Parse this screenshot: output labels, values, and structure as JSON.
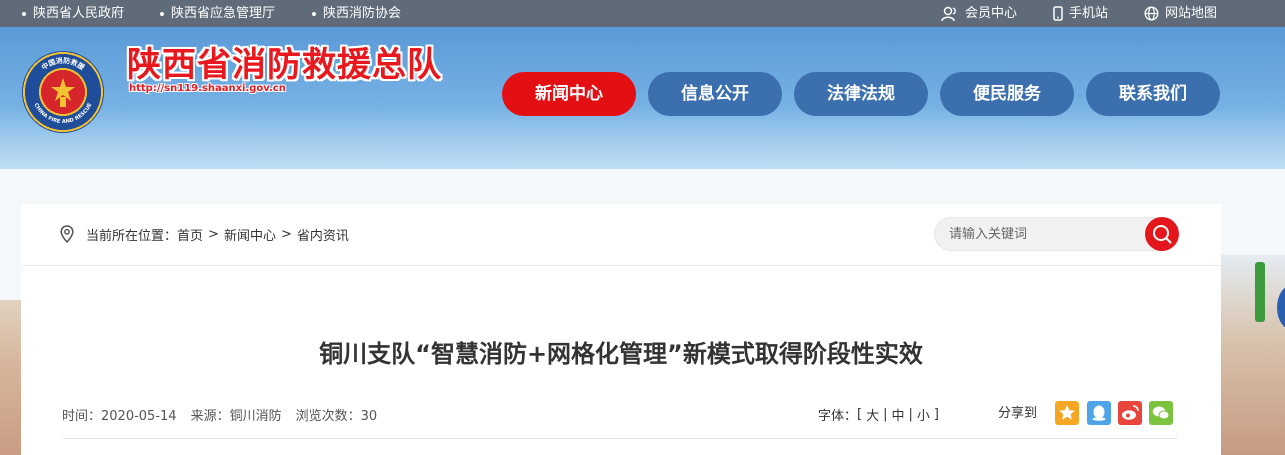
{
  "topbar": {
    "left_links": [
      "陕西省人民政府",
      "陕西省应急管理厅",
      "陕西消防协会"
    ],
    "right_links": [
      {
        "label": "会员中心",
        "icon": "user-icon"
      },
      {
        "label": "手机站",
        "icon": "mobile-icon"
      },
      {
        "label": "网站地图",
        "icon": "globe-icon"
      }
    ]
  },
  "header": {
    "site_title": "陕西省消防救援总队",
    "site_url": "http://sn119.shaanxi.gov.cn",
    "emblem_top_text": "中国消防救援",
    "emblem_ring_text": "CHINA FIRE AND RESCUE"
  },
  "nav": {
    "items": [
      {
        "label": "新闻中心",
        "active": true
      },
      {
        "label": "信息公开",
        "active": false
      },
      {
        "label": "法律法规",
        "active": false
      },
      {
        "label": "便民服务",
        "active": false
      },
      {
        "label": "联系我们",
        "active": false
      }
    ]
  },
  "breadcrumb": {
    "prefix": "当前所在位置：",
    "items": [
      "首页",
      "新闻中心",
      "省内资讯"
    ],
    "separator": ">"
  },
  "search": {
    "placeholder": "请输入关键词",
    "value": ""
  },
  "article": {
    "title": "铜川支队“智慧消防+网格化管理”新模式取得阶段性实效",
    "time_label": "时间：2020-05-14",
    "source_label": "来源：铜川消防",
    "views_label": "浏览次数：30"
  },
  "font_size": {
    "label": "字体：",
    "open": "[",
    "large": "大",
    "medium": "中",
    "small": "小",
    "close": "]",
    "sep": "|"
  },
  "share": {
    "label": "分享到",
    "targets": [
      {
        "icon": "qzone-icon",
        "color": "#f5a623"
      },
      {
        "icon": "qq-icon",
        "color": "#4fa3e8"
      },
      {
        "icon": "weibo-icon",
        "color": "#e8453c"
      },
      {
        "icon": "wechat-icon",
        "color": "#7cc33f"
      }
    ]
  },
  "colors": {
    "accent_red": "#e30f12",
    "nav_blue": "#3b6fad",
    "topbar_gray": "#5f6b78"
  }
}
